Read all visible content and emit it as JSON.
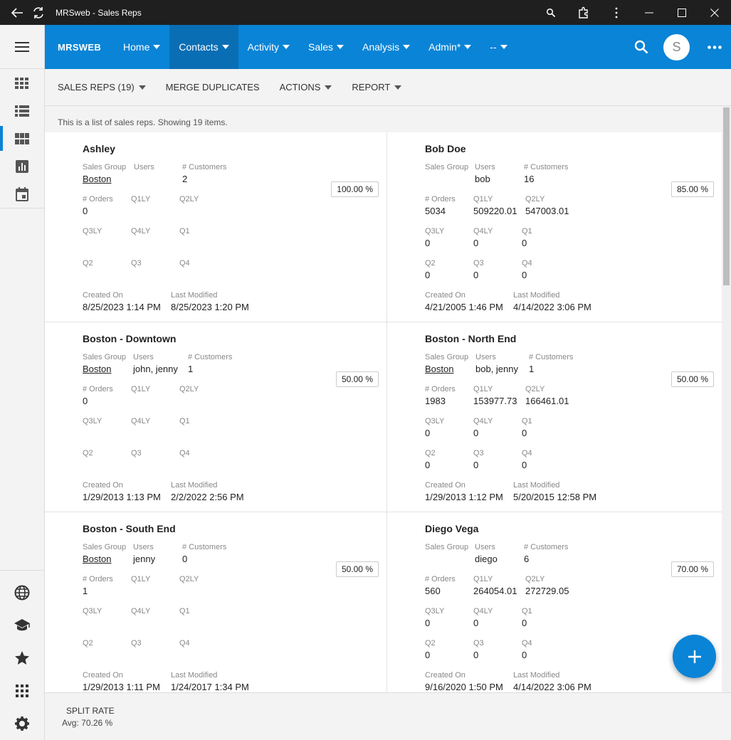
{
  "window": {
    "title": "MRSweb - Sales Reps"
  },
  "nav": {
    "brand": "MRSWEB",
    "items": [
      {
        "label": "Home"
      },
      {
        "label": "Contacts",
        "active": true
      },
      {
        "label": "Activity"
      },
      {
        "label": "Sales"
      },
      {
        "label": "Analysis"
      },
      {
        "label": "Admin*"
      },
      {
        "label": "--"
      }
    ],
    "avatar_initial": "S"
  },
  "toolbar": {
    "sales_reps": "SALES REPS (19)",
    "merge": "MERGE DUPLICATES",
    "actions": "ACTIONS",
    "report": "REPORT"
  },
  "info": "This is a list of sales reps. Showing 19 items.",
  "labels": {
    "sales_group": "Sales Group",
    "users": "Users",
    "customers": "# Customers",
    "orders": "# Orders",
    "q1ly": "Q1LY",
    "q2ly": "Q2LY",
    "q3ly": "Q3LY",
    "q4ly": "Q4LY",
    "q1": "Q1",
    "q2": "Q2",
    "q3": "Q3",
    "q4": "Q4",
    "created_on": "Created On",
    "last_modified": "Last Modified"
  },
  "reps": [
    {
      "name": "Ashley",
      "sales_group": "Boston",
      "users": "",
      "customers": "2",
      "orders": "0",
      "q1ly": "",
      "q2ly": "",
      "q3ly": "",
      "q4ly": "",
      "q1": "",
      "q2": "",
      "q3": "",
      "q4": "",
      "created_on": "8/25/2023 1:14 PM",
      "last_modified": "8/25/2023 1:20 PM",
      "rate": "100.00 %"
    },
    {
      "name": "Bob Doe",
      "sales_group": "",
      "users": "bob",
      "customers": "16",
      "orders": "5034",
      "q1ly": "509220.01",
      "q2ly": "547003.01",
      "q3ly": "0",
      "q4ly": "0",
      "q1": "0",
      "q2": "0",
      "q3": "0",
      "q4": "0",
      "created_on": "4/21/2005 1:46 PM",
      "last_modified": "4/14/2022 3:06 PM",
      "rate": "85.00 %"
    },
    {
      "name": "Boston - Downtown",
      "sales_group": "Boston",
      "users": "john, jenny",
      "customers": "1",
      "orders": "0",
      "q1ly": "",
      "q2ly": "",
      "q3ly": "",
      "q4ly": "",
      "q1": "",
      "q2": "",
      "q3": "",
      "q4": "",
      "created_on": "1/29/2013 1:13 PM",
      "last_modified": "2/2/2022 2:56 PM",
      "rate": "50.00 %"
    },
    {
      "name": "Boston - North End",
      "sales_group": "Boston",
      "users": "bob, jenny",
      "customers": "1",
      "orders": "1983",
      "q1ly": "153977.73",
      "q2ly": "166461.01",
      "q3ly": "0",
      "q4ly": "0",
      "q1": "0",
      "q2": "0",
      "q3": "0",
      "q4": "0",
      "created_on": "1/29/2013 1:12 PM",
      "last_modified": "5/20/2015 12:58 PM",
      "rate": "50.00 %"
    },
    {
      "name": "Boston - South End",
      "sales_group": "Boston",
      "users": "jenny",
      "customers": "0",
      "orders": "1",
      "q1ly": "",
      "q2ly": "",
      "q3ly": "",
      "q4ly": "",
      "q1": "",
      "q2": "",
      "q3": "",
      "q4": "",
      "created_on": "1/29/2013 1:11 PM",
      "last_modified": "1/24/2017 1:34 PM",
      "rate": "50.00 %"
    },
    {
      "name": "Diego Vega",
      "sales_group": "",
      "users": "diego",
      "customers": "6",
      "orders": "560",
      "q1ly": "264054.01",
      "q2ly": "272729.05",
      "q3ly": "0",
      "q4ly": "0",
      "q1": "0",
      "q2": "0",
      "q3": "0",
      "q4": "0",
      "created_on": "9/16/2020 1:50 PM",
      "last_modified": "4/14/2022 3:06 PM",
      "rate": "70.00 %"
    }
  ],
  "footer": {
    "title": "SPLIT RATE",
    "avg_label": "Avg:",
    "avg_value": "70.26 %"
  }
}
